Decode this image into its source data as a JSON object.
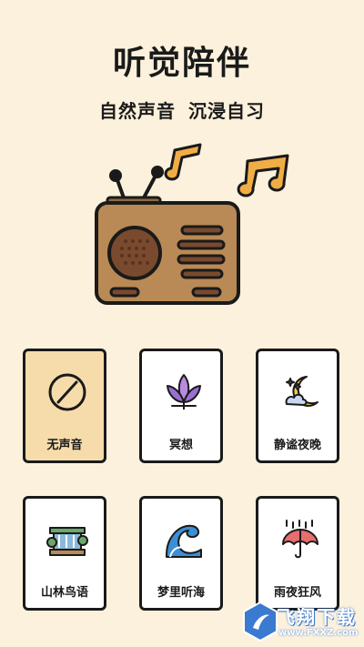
{
  "header": {
    "title": "听觉陪伴",
    "subtitle": "自然声音 沉浸自习"
  },
  "sounds": [
    {
      "label": "无声音",
      "icon": "no-sound-icon",
      "selected": true
    },
    {
      "label": "冥想",
      "icon": "lotus-icon",
      "selected": false
    },
    {
      "label": "静谧夜晚",
      "icon": "moon-stars-icon",
      "selected": false
    },
    {
      "label": "山林鸟语",
      "icon": "waterfall-icon",
      "selected": false
    },
    {
      "label": "梦里听海",
      "icon": "wave-icon",
      "selected": false
    },
    {
      "label": "雨夜狂风",
      "icon": "rain-umbrella-icon",
      "selected": false
    }
  ],
  "colors": {
    "background": "#fcf1dc",
    "selected_tile": "#f6dcab",
    "radio_body": "#b98a55",
    "note": "#f1ad45"
  },
  "watermark": {
    "brand": "飞翔下载",
    "url": "www.FXXZ.com"
  }
}
